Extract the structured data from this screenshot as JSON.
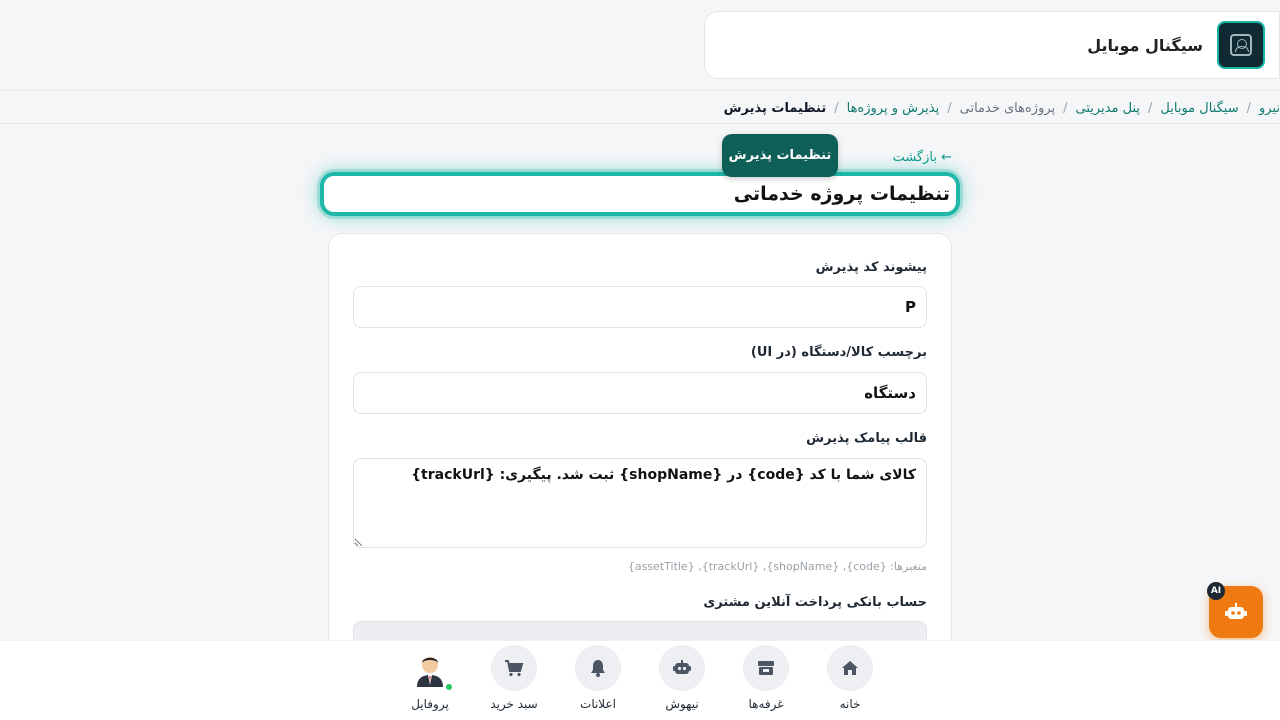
{
  "header": {
    "shop_name": "سیگنال موبایل"
  },
  "breadcrumb": [
    {
      "label": "نیرو",
      "type": "link"
    },
    {
      "label": "سیگنال موبایل",
      "type": "link"
    },
    {
      "label": "پنل مدیریتی",
      "type": "link"
    },
    {
      "label": "پروژه‌های خدماتی",
      "type": "plain"
    },
    {
      "label": "پذیرش و پروژه‌ها",
      "type": "link"
    },
    {
      "label": "تنظیمات پذیرش",
      "type": "current"
    }
  ],
  "back_label": "← بازگشت",
  "tooltip": "تنظیمات پذیرش",
  "page_title": "تنظیمات پروژه خدماتی",
  "form": {
    "prefix_label": "پیشوند کد پذیرش",
    "prefix_value": "P",
    "asset_label": "برچسب کالا/دستگاه (در UI)",
    "asset_value": "دستگاه",
    "sms_label": "قالب پیامک پذیرش",
    "sms_value": "کالای شما با کد {code} در {shopName} ثبت شد. پیگیری: {trackUrl}",
    "sms_hint": "متغیرها: {code}, {shopName}, {trackUrl}, {assetTitle}",
    "bank_label": "حساب بانکی پرداخت آنلاین مشتری"
  },
  "ai_badge": "AI",
  "nav": [
    {
      "label": "خانه",
      "icon": "home-icon"
    },
    {
      "label": "غرفه‌ها",
      "icon": "store-icon"
    },
    {
      "label": "نیهوش",
      "icon": "robot-icon"
    },
    {
      "label": "اعلانات",
      "icon": "bell-icon"
    },
    {
      "label": "سبد خرید",
      "icon": "cart-icon"
    },
    {
      "label": "پروفایل",
      "icon": "avatar"
    }
  ],
  "colors": {
    "accent": "#1fb7a8",
    "accent_dark": "#0f5f59",
    "fab": "#f07a12"
  }
}
